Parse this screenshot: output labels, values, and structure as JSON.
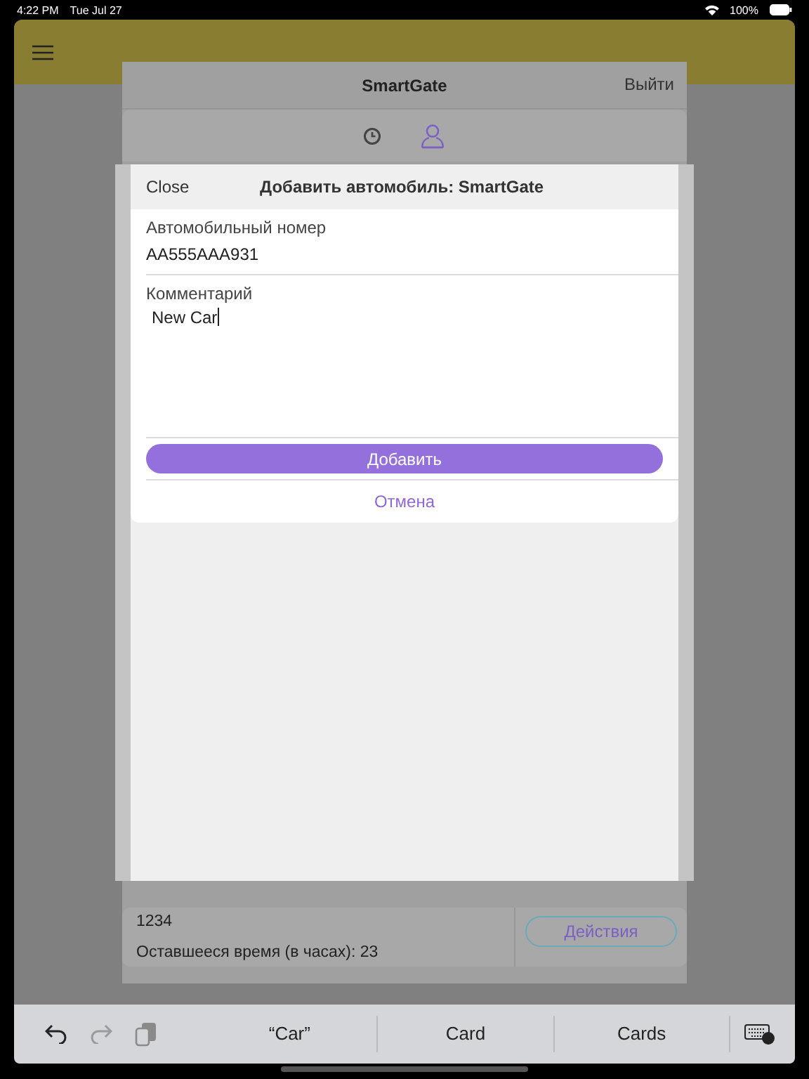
{
  "status_bar": {
    "time": "4:22 PM",
    "date": "Tue Jul 27",
    "battery": "100%"
  },
  "sheet": {
    "title": "SmartGate",
    "logout": "Выйти",
    "tabs": [
      {
        "kind": "clock",
        "selected": false
      },
      {
        "kind": "person",
        "selected": true
      }
    ],
    "row": {
      "id": "1234",
      "remaining": "Оставшееся время (в часах): 23",
      "action": "Действия"
    }
  },
  "dialog": {
    "close": "Close",
    "title": "Добавить автомобиль: SmartGate",
    "fields": [
      {
        "label": "Автомобильный номер",
        "value": "AA555AAA931",
        "focused": false
      },
      {
        "label": "Комментарий",
        "value": "New Car",
        "focused": true
      }
    ],
    "submit": "Добавить",
    "cancel": "Отмена"
  },
  "keyboard_bar": {
    "tools": [
      {
        "kind": "undo",
        "disabled": false
      },
      {
        "kind": "redo",
        "disabled": true
      },
      {
        "kind": "paste",
        "disabled": false
      }
    ],
    "suggestions": [
      "“Car”",
      "Card",
      "Cards"
    ]
  }
}
